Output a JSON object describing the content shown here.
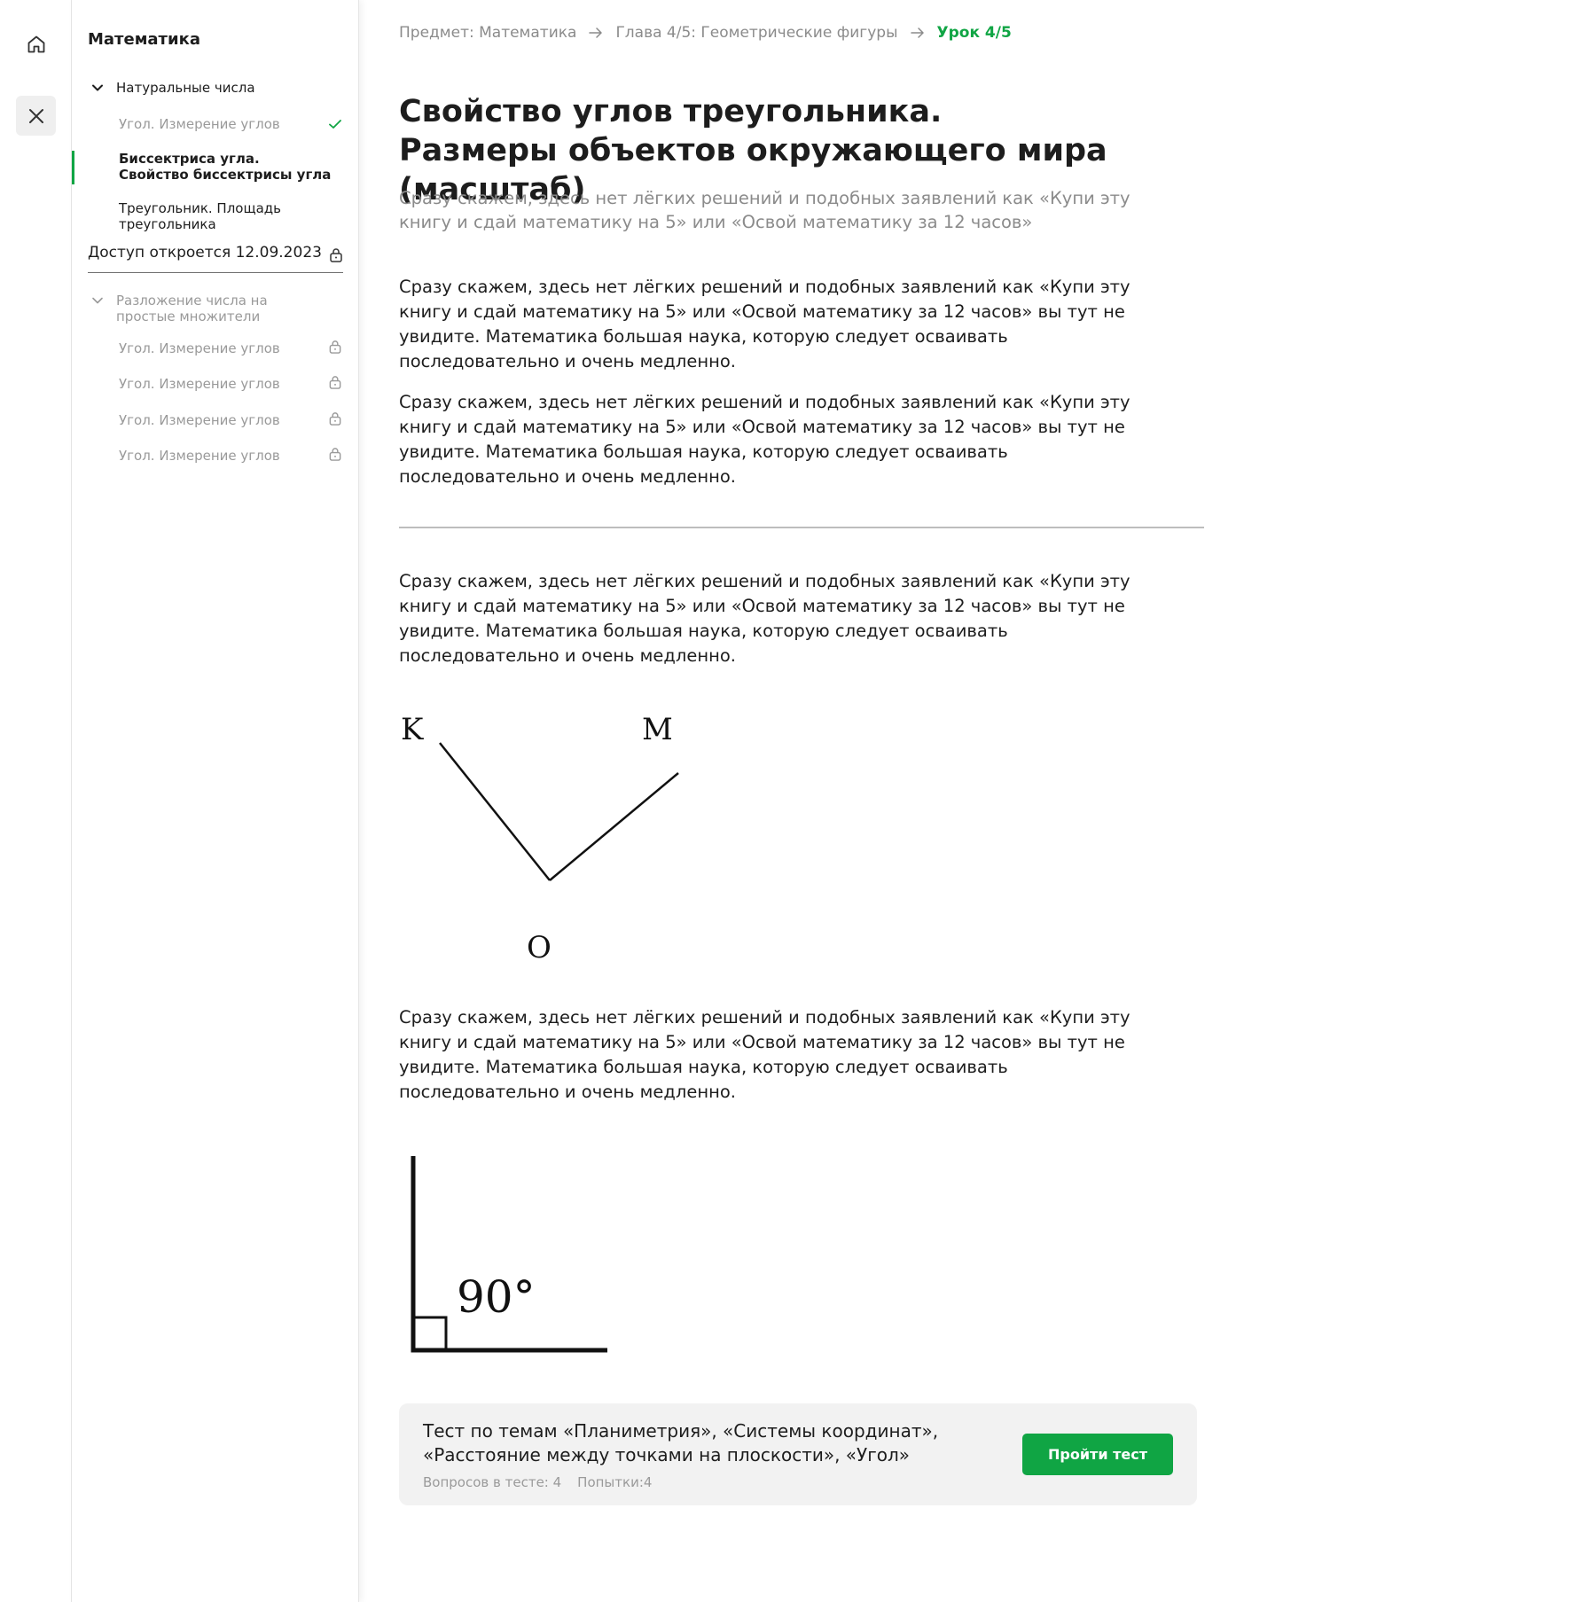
{
  "sidebar": {
    "title": "Математика",
    "sections": [
      {
        "label": "Натуральные числа",
        "items": [
          {
            "label": "Угол. Измерение углов",
            "status": "done"
          },
          {
            "label": "Биссектриса угла. Свойство биссектрисы угла",
            "status": "active"
          },
          {
            "label": "Треугольник. Площадь треугольника",
            "status": "open"
          }
        ]
      },
      {
        "label": "Разложение числа на простые множители",
        "items": [
          {
            "label": "Угол. Измерение углов",
            "status": "locked"
          },
          {
            "label": "Угол. Измерение углов",
            "status": "locked"
          },
          {
            "label": "Угол. Измерение углов",
            "status": "locked"
          },
          {
            "label": "Угол. Измерение углов",
            "status": "locked"
          }
        ]
      }
    ],
    "access_text": "Доступ откроется 12.09.2023"
  },
  "breadcrumb": {
    "subject": "Предмет: Математика",
    "chapter": "Глава 4/5: Геометрические фигуры",
    "lesson": "Урок 4/5"
  },
  "lesson": {
    "title": "Свойство углов треугольника. Размеры объектов окружающего мира (масштаб)",
    "lead": "Сразу скажем, здесь нет лёгких решений и подобных заявлений как «Купи эту книгу и сдай математику на 5» или «Освой математику за 12 часов»",
    "paragraphs": [
      "Сразу скажем, здесь нет лёгких решений и подобных заявлений как «Купи эту книгу и сдай математику на 5» или «Освой математику за 12 часов» вы тут не увидите. Математика большая наука, которую следует осваивать последовательно и очень медленно.",
      "Сразу скажем, здесь нет лёгких решений и подобных заявлений как «Купи эту книгу и сдай математику на 5» или «Освой математику за 12 часов» вы тут не увидите. Математика большая наука, которую следует осваивать последовательно и очень медленно.",
      "Сразу скажем, здесь нет лёгких решений и подобных заявлений как «Купи эту книгу и сдай математику на 5» или «Освой математику за 12 часов» вы тут не увидите. Математика большая наука, которую следует осваивать последовательно и очень медленно.",
      "Сразу скажем, здесь нет лёгких решений и подобных заявлений как «Купи эту книгу и сдай математику на 5» или «Освой математику за 12 часов» вы тут не увидите. Математика большая наука, которую следует осваивать последовательно и очень медленно."
    ],
    "figure_angle": {
      "label_k": "K",
      "label_m": "M",
      "label_o": "O"
    },
    "figure_right_angle": {
      "label": "90°"
    }
  },
  "test": {
    "title": "Тест по темам «Планиметрия», «Системы координат», «Расстояние между точками на плоскости», «Угол»",
    "questions": "Вопросов в тесте: 4",
    "attempts": "Попытки:4",
    "button_label": "Пройти тест"
  },
  "colors": {
    "accent": "#10a544",
    "muted": "#8b8b8b",
    "card_bg": "#f2f2f2"
  },
  "icons": {
    "rail": [
      "home-icon",
      "close-icon"
    ],
    "done": "check-icon",
    "locked": "lock-icon",
    "expand": "chevron-down-icon",
    "breadcrumb": "arrow-right-icon"
  }
}
